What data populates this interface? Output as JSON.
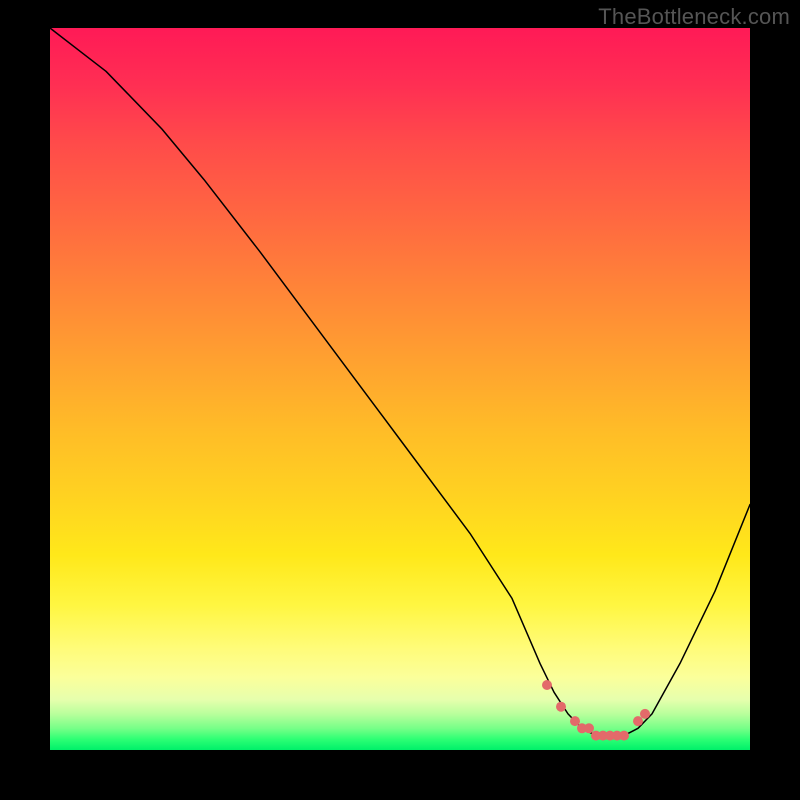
{
  "attribution": "TheBottleneck.com",
  "colors": {
    "point_fill": "#e36a6a",
    "curve_stroke": "#000000"
  },
  "chart_data": {
    "type": "line",
    "title": "",
    "xlabel": "",
    "ylabel": "",
    "xlim": [
      0,
      100
    ],
    "ylim": [
      0,
      100
    ],
    "series": [
      {
        "name": "bottleneck-curve",
        "x": [
          0,
          4,
          8,
          12,
          16,
          22,
          30,
          40,
          50,
          60,
          66,
          70,
          72,
          74,
          76,
          78,
          80,
          82,
          84,
          86,
          90,
          95,
          100
        ],
        "y": [
          100,
          97,
          94,
          90,
          86,
          79,
          69,
          56,
          43,
          30,
          21,
          12,
          8,
          5,
          3,
          2,
          2,
          2,
          3,
          5,
          12,
          22,
          34
        ]
      }
    ],
    "highlight_points": {
      "name": "optimal-range",
      "x": [
        71,
        73,
        75,
        76,
        77,
        78,
        79,
        80,
        81,
        82,
        84,
        85
      ],
      "y": [
        9,
        6,
        4,
        3,
        3,
        2,
        2,
        2,
        2,
        2,
        4,
        5
      ]
    },
    "gradient_stops": [
      {
        "pos": 0.0,
        "color": "#ff1a56"
      },
      {
        "pos": 0.5,
        "color": "#ffbd27"
      },
      {
        "pos": 0.85,
        "color": "#fff642"
      },
      {
        "pos": 1.0,
        "color": "#00f06a"
      }
    ]
  }
}
